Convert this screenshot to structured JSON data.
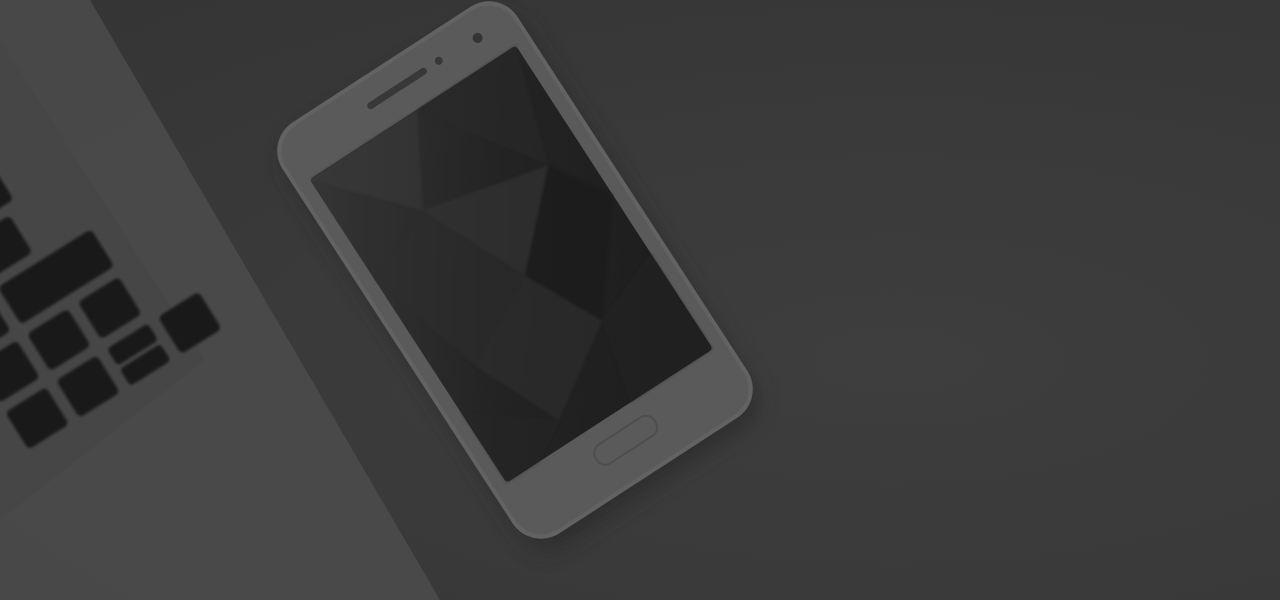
{
  "scene": {
    "description_icons": [
      "laptop-keyboard-icon",
      "smartphone-icon"
    ],
    "colors": {
      "desk": "#424242",
      "laptop_body": "#5a5a5a",
      "keys": "#1b1b1b",
      "phone_body": "#6a6a6a",
      "phone_screen": "#2a2a2a"
    }
  }
}
